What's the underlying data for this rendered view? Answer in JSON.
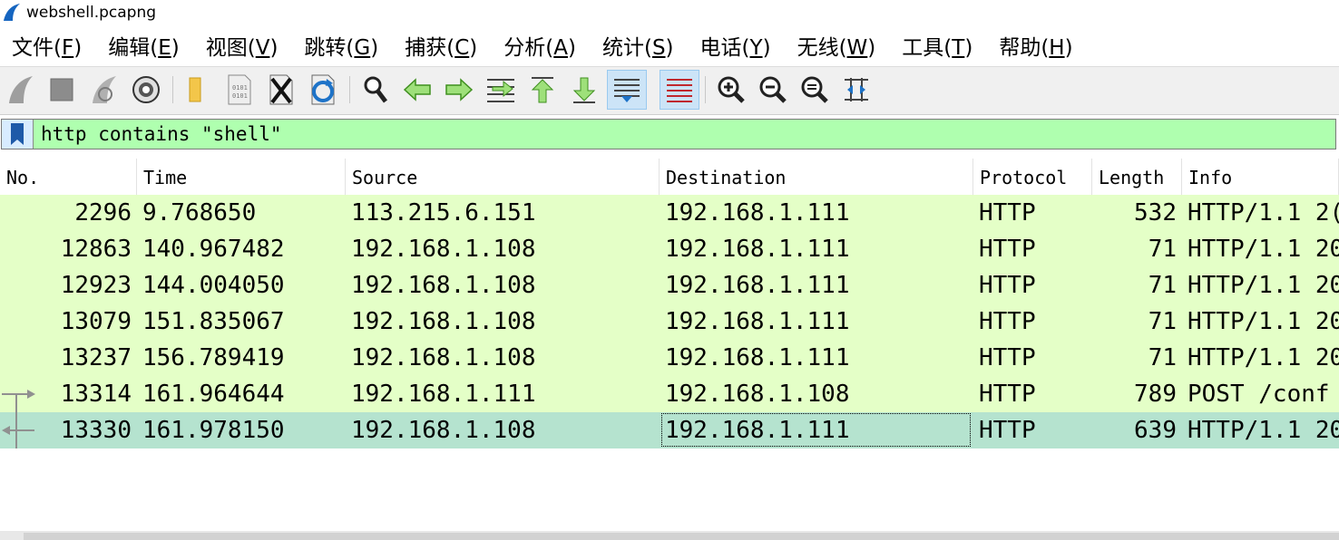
{
  "window": {
    "title": "webshell.pcapng"
  },
  "menu": [
    {
      "label": "文件(",
      "mnemonic": "F",
      "close": ")"
    },
    {
      "label": "编辑(",
      "mnemonic": "E",
      "close": ")"
    },
    {
      "label": "视图(",
      "mnemonic": "V",
      "close": ")"
    },
    {
      "label": "跳转(",
      "mnemonic": "G",
      "close": ")"
    },
    {
      "label": "捕获(",
      "mnemonic": "C",
      "close": ")"
    },
    {
      "label": "分析(",
      "mnemonic": "A",
      "close": ")"
    },
    {
      "label": "统计(",
      "mnemonic": "S",
      "close": ")"
    },
    {
      "label": "电话(",
      "mnemonic": "Y",
      "close": ")"
    },
    {
      "label": "无线(",
      "mnemonic": "W",
      "close": ")"
    },
    {
      "label": "工具(",
      "mnemonic": "T",
      "close": ")"
    },
    {
      "label": "帮助(",
      "mnemonic": "H",
      "close": ")"
    }
  ],
  "toolbar": {
    "icons": [
      "start-capture-icon",
      "stop-capture-icon",
      "restart-capture-icon",
      "capture-options-icon",
      "open-file-icon",
      "save-file-icon",
      "close-file-icon",
      "reload-file-icon",
      "find-packet-icon",
      "go-back-icon",
      "go-forward-icon",
      "go-to-packet-icon",
      "first-packet-icon",
      "last-packet-icon",
      "autoscroll-icon",
      "colorize-icon",
      "zoom-in-icon",
      "zoom-out-icon",
      "normal-size-icon",
      "resize-columns-icon"
    ]
  },
  "filter": {
    "value": "http contains \"shell\""
  },
  "columns": [
    "No.",
    "Time",
    "Source",
    "Destination",
    "Protocol",
    "Length",
    "Info"
  ],
  "packets": [
    {
      "no": "2296",
      "time": "9.768650",
      "source": "113.215.6.151",
      "destination": "192.168.1.111",
      "protocol": "HTTP",
      "length": "532",
      "info": "HTTP/1.1 2("
    },
    {
      "no": "12863",
      "time": "140.967482",
      "source": "192.168.1.108",
      "destination": "192.168.1.111",
      "protocol": "HTTP",
      "length": "71",
      "info": "HTTP/1.1 20"
    },
    {
      "no": "12923",
      "time": "144.004050",
      "source": "192.168.1.108",
      "destination": "192.168.1.111",
      "protocol": "HTTP",
      "length": "71",
      "info": "HTTP/1.1 20"
    },
    {
      "no": "13079",
      "time": "151.835067",
      "source": "192.168.1.108",
      "destination": "192.168.1.111",
      "protocol": "HTTP",
      "length": "71",
      "info": "HTTP/1.1 20"
    },
    {
      "no": "13237",
      "time": "156.789419",
      "source": "192.168.1.108",
      "destination": "192.168.1.111",
      "protocol": "HTTP",
      "length": "71",
      "info": "HTTP/1.1 20"
    },
    {
      "no": "13314",
      "time": "161.964644",
      "source": "192.168.1.111",
      "destination": "192.168.1.108",
      "protocol": "HTTP",
      "length": "789",
      "info": "POST /conf"
    },
    {
      "no": "13330",
      "time": "161.978150",
      "source": "192.168.1.108",
      "destination": "192.168.1.111",
      "protocol": "HTTP",
      "length": "639",
      "info": "HTTP/1.1 20"
    }
  ],
  "selected_packet": "13330",
  "colors": {
    "row_bg": "#e4ffc7",
    "selected_bg": "#b5e3cf",
    "filter_bg": "#afffaf"
  }
}
